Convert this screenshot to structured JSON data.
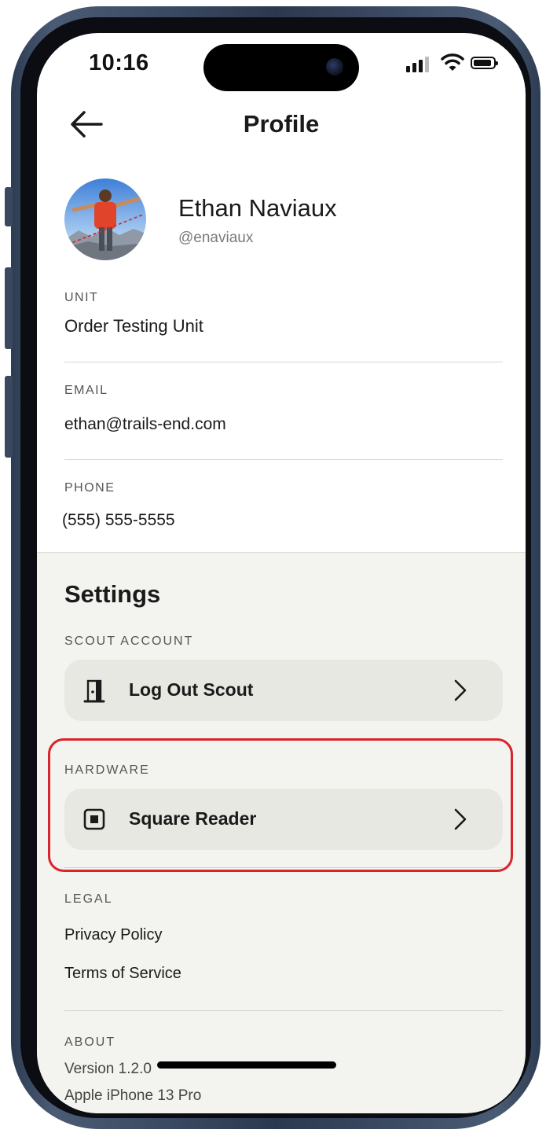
{
  "status_bar": {
    "time": "10:16"
  },
  "header": {
    "title": "Profile"
  },
  "profile": {
    "name": "Ethan Naviaux",
    "handle": "@enaviaux",
    "fields": [
      {
        "label": "UNIT",
        "value": "Order Testing Unit"
      },
      {
        "label": "EMAIL",
        "value": "ethan@trails-end.com"
      },
      {
        "label": "PHONE",
        "value": "(555) 555-5555"
      }
    ]
  },
  "settings": {
    "heading": "Settings",
    "scout_account": {
      "label": "SCOUT ACCOUNT",
      "button": "Log Out Scout"
    },
    "hardware": {
      "label": "HARDWARE",
      "button": "Square Reader"
    },
    "legal": {
      "label": "LEGAL",
      "links": [
        "Privacy Policy",
        "Terms of Service"
      ]
    },
    "about": {
      "label": "ABOUT",
      "version": "Version 1.2.0",
      "device": "Apple iPhone 13 Pro"
    }
  },
  "colors": {
    "highlight": "#d8242b",
    "settings_bg": "#f3f3ef",
    "row_bg": "#e8e8e3",
    "frame": "#2b3950"
  },
  "icons": {
    "back": "arrow-left-icon",
    "logout": "door-icon",
    "reader": "square-reader-icon",
    "chevron": "chevron-right-icon"
  }
}
